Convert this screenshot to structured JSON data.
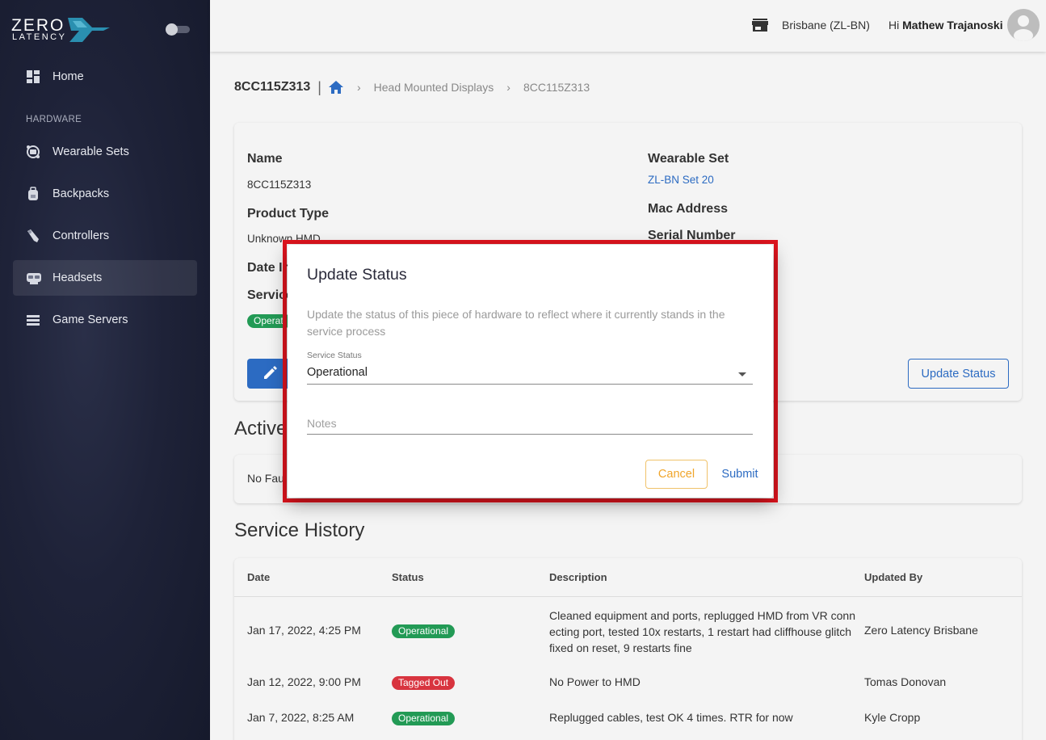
{
  "brand": {
    "line1": "ZERO",
    "line2": "LATENCY",
    "accent": "#2a8fb0"
  },
  "sidebar": {
    "section_label": "HARDWARE",
    "items": [
      {
        "label": "Home",
        "icon": "dashboard-icon"
      },
      {
        "label": "Wearable Sets",
        "icon": "wearable-set-icon"
      },
      {
        "label": "Backpacks",
        "icon": "backpack-icon"
      },
      {
        "label": "Controllers",
        "icon": "controller-icon"
      },
      {
        "label": "Headsets",
        "icon": "headset-icon",
        "active": true
      },
      {
        "label": "Game Servers",
        "icon": "server-icon"
      }
    ]
  },
  "topbar": {
    "location": "Brisbane (ZL-BN)",
    "greeting_prefix": "Hi",
    "user_name": "Mathew Trajanoski"
  },
  "breadcrumb": {
    "title": "8CC115Z313",
    "separator": "|",
    "items": [
      "Head Mounted Displays",
      "8CC115Z313"
    ]
  },
  "details": {
    "name_label": "Name",
    "name_value": "8CC115Z313",
    "product_type_label": "Product Type",
    "product_type_value": "Unknown HMD",
    "date_label": "Date In",
    "service_label": "Service",
    "service_chip": "Operati",
    "wearable_set_label": "Wearable Set",
    "wearable_set_value": "ZL-BN Set 20",
    "mac_label": "Mac Address",
    "serial_label": "Serial Number",
    "update_status_button": "Update Status"
  },
  "active_faults": {
    "title": "Active",
    "empty_text": "No Fau"
  },
  "service_history": {
    "title": "Service History",
    "columns": [
      "Date",
      "Status",
      "Description",
      "Updated By"
    ],
    "rows": [
      {
        "date": "Jan 17, 2022, 4:25 PM",
        "status": "Operational",
        "status_color": "#229a55",
        "description_lines": [
          "Cleaned equipment and ports, replugged HMD from VR conn",
          "ecting port, tested 10x restarts, 1 restart had cliffhouse glitch",
          "fixed on reset, 9 restarts fine"
        ],
        "updated_by": "Zero Latency Brisbane"
      },
      {
        "date": "Jan 12, 2022, 9:00 PM",
        "status": "Tagged Out",
        "status_color": "#d8343f",
        "description_lines": [
          "No Power to HMD"
        ],
        "updated_by": "Tomas Donovan"
      },
      {
        "date": "Jan 7, 2022, 8:25 AM",
        "status": "Operational",
        "status_color": "#229a55",
        "description_lines": [
          "Replugged cables, test OK 4 times. RTR for now"
        ],
        "updated_by": "Kyle Cropp"
      }
    ]
  },
  "modal": {
    "title": "Update Status",
    "description": "Update the status of this piece of hardware to reflect where it currently stands in the service process",
    "service_status_label": "Service Status",
    "service_status_value": "Operational",
    "notes_placeholder": "Notes",
    "cancel_label": "Cancel",
    "submit_label": "Submit",
    "highlight_color": "#e0141e"
  }
}
